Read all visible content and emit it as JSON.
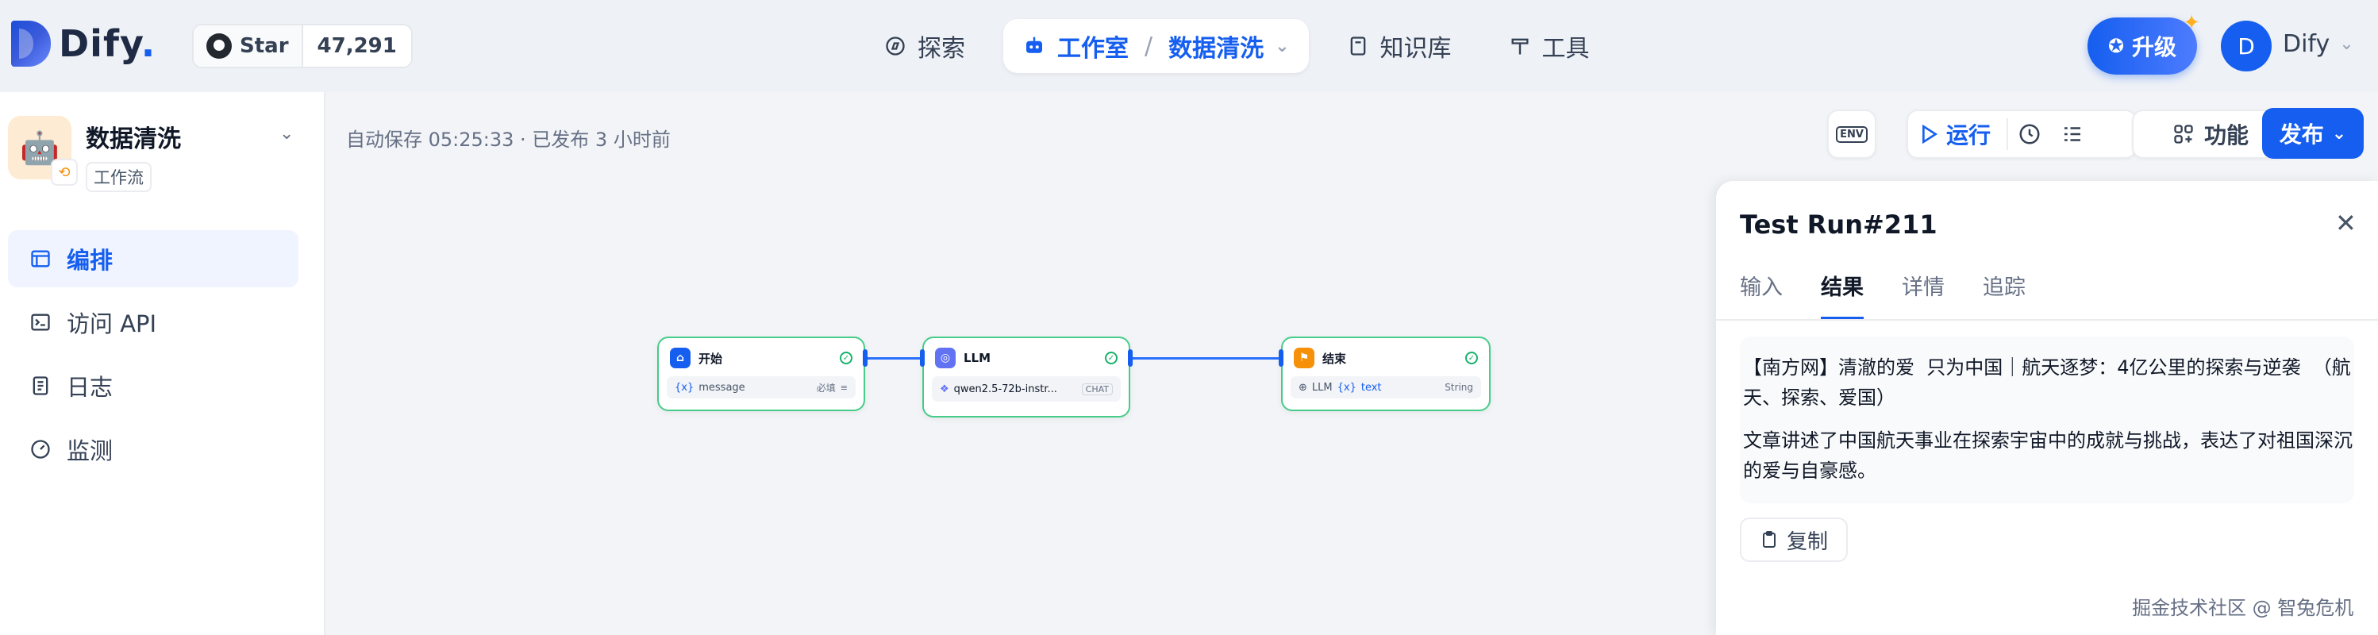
{
  "brand": {
    "name": "Dify",
    "dot": "."
  },
  "github": {
    "star_label": "Star",
    "count": "47,291"
  },
  "nav": {
    "explore": "探索",
    "studio": "工作室",
    "studio_sep": "/",
    "current_app": "数据清洗",
    "knowledge": "知识库",
    "tools": "工具"
  },
  "header": {
    "upgrade": "升级",
    "avatar_letter": "D",
    "user_name": "Dify"
  },
  "app": {
    "title": "数据清洗",
    "type": "工作流"
  },
  "sidebar": {
    "items": [
      {
        "label": "编排",
        "icon": "layout-icon"
      },
      {
        "label": "访问 API",
        "icon": "terminal-icon"
      },
      {
        "label": "日志",
        "icon": "file-text-icon"
      },
      {
        "label": "监测",
        "icon": "gauge-icon"
      }
    ]
  },
  "canvas": {
    "autosave": "自动保存 05:25:33 · 已发布 3 小时前"
  },
  "toolbar": {
    "env": "ENV",
    "run": "运行",
    "features": "功能",
    "publish": "发布"
  },
  "nodes": {
    "start": {
      "title": "开始",
      "var": "message",
      "required": "必填"
    },
    "llm": {
      "title": "LLM",
      "model": "qwen2.5-72b-instr...",
      "tag": "CHAT"
    },
    "end": {
      "title": "结束",
      "source": "LLM",
      "var": "text",
      "type": "String"
    }
  },
  "panel": {
    "title": "Test Run#211",
    "tabs": [
      "输入",
      "结果",
      "详情",
      "追踪"
    ],
    "result_line1": "【南方网】清澈的爱  只为中国｜航天逐梦：4亿公里的探索与逆袭  （航天、探索、爱国）",
    "result_line2": "文章讲述了中国航天事业在探索宇宙中的成就与挑战，表达了对祖国深沉的爱与自豪感。",
    "copy": "复制"
  },
  "watermark": "掘金技术社区 @ 智兔危机",
  "colors": {
    "accent": "#155eef",
    "success": "#17b26a",
    "node_start": "#155eef",
    "node_llm": "#6172f3",
    "node_end": "#f79009"
  }
}
